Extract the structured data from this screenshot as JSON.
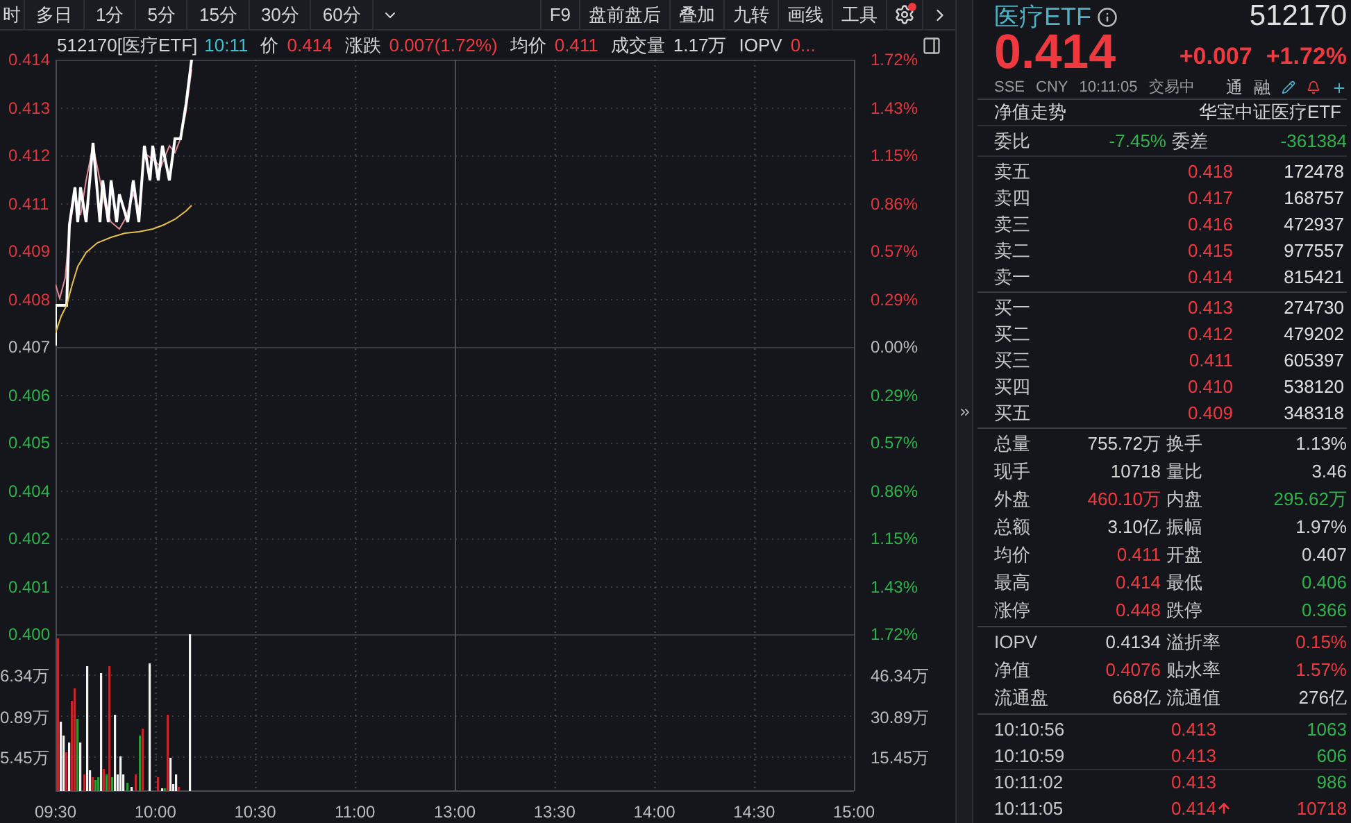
{
  "toolbar": {
    "periods": [
      {
        "label": "时"
      },
      {
        "label": "多日"
      },
      {
        "label": "1分"
      },
      {
        "label": "5分"
      },
      {
        "label": "15分"
      },
      {
        "label": "30分"
      },
      {
        "label": "60分"
      }
    ],
    "tools": [
      "F9",
      "盘前盘后",
      "叠加",
      "九转",
      "画线",
      "工具"
    ],
    "settings_alert": true
  },
  "info_bar": {
    "title": "512170[医疗ETF]",
    "time": "10:11",
    "fields": [
      {
        "label": "价",
        "value": "0.414",
        "color": "#f0393f"
      },
      {
        "label": "涨跌",
        "value": "0.007(1.72%)",
        "color": "#f0393f"
      },
      {
        "label": "均价",
        "value": "0.411",
        "color": "#f0393f"
      },
      {
        "label": "成交量",
        "value": "1.17万",
        "color": "#d6d6d6"
      },
      {
        "label": "IOPV",
        "value": "0...",
        "color": "#f0393f"
      }
    ]
  },
  "chart": {
    "price_labels": [
      {
        "text": "0.414",
        "color": "#e0383e"
      },
      {
        "text": "0.413",
        "color": "#e0383e"
      },
      {
        "text": "0.412",
        "color": "#e0383e"
      },
      {
        "text": "0.411",
        "color": "#e0383e"
      },
      {
        "text": "0.409",
        "color": "#e0383e"
      },
      {
        "text": "0.408",
        "color": "#e0383e"
      },
      {
        "text": "0.407",
        "color": "#bdbdbd"
      },
      {
        "text": "0.406",
        "color": "#2fb34a"
      },
      {
        "text": "0.405",
        "color": "#2fb34a"
      },
      {
        "text": "0.404",
        "color": "#2fb34a"
      },
      {
        "text": "0.402",
        "color": "#2fb34a"
      },
      {
        "text": "0.401",
        "color": "#2fb34a"
      },
      {
        "text": "0.400",
        "color": "#2fb34a"
      }
    ],
    "percent_labels": [
      {
        "text": "1.72%",
        "color": "#e0383e"
      },
      {
        "text": "1.43%",
        "color": "#e0383e"
      },
      {
        "text": "1.15%",
        "color": "#e0383e"
      },
      {
        "text": "0.86%",
        "color": "#e0383e"
      },
      {
        "text": "0.57%",
        "color": "#e0383e"
      },
      {
        "text": "0.29%",
        "color": "#e0383e"
      },
      {
        "text": "0.00%",
        "color": "#bdbdbd"
      },
      {
        "text": "0.29%",
        "color": "#2fb34a"
      },
      {
        "text": "0.57%",
        "color": "#2fb34a"
      },
      {
        "text": "0.86%",
        "color": "#2fb34a"
      },
      {
        "text": "1.15%",
        "color": "#2fb34a"
      },
      {
        "text": "1.43%",
        "color": "#2fb34a"
      },
      {
        "text": "1.72%",
        "color": "#2fb34a"
      }
    ],
    "volume_labels_left": [
      "6.34万",
      "0.89万",
      "5.45万"
    ],
    "volume_labels_right": [
      "46.34万",
      "30.89万",
      "15.45万"
    ],
    "time_labels": [
      "09:30",
      "10:00",
      "10:30",
      "11:00",
      "13:00",
      "13:30",
      "14:00",
      "14:30",
      "15:00"
    ]
  },
  "quote": {
    "name": "医疗ETF",
    "code": "512170",
    "price": "0.414",
    "change": "+0.007",
    "change_pct": "+1.72%",
    "exchange": "SSE",
    "currency": "CNY",
    "time": "10:11:05",
    "status": "交易中",
    "flags": [
      "通",
      "融"
    ],
    "nav_link": "净值走势",
    "fund_name": "华宝中证医疗ETF",
    "ratio": {
      "label": "委比",
      "value": "-7.45%",
      "diff_label": "委差",
      "diff_value": "-361384"
    },
    "asks": [
      {
        "label": "卖五",
        "price": "0.418",
        "volume": "172478"
      },
      {
        "label": "卖四",
        "price": "0.417",
        "volume": "168757"
      },
      {
        "label": "卖三",
        "price": "0.416",
        "volume": "472937"
      },
      {
        "label": "卖二",
        "price": "0.415",
        "volume": "977557"
      },
      {
        "label": "卖一",
        "price": "0.414",
        "volume": "815421"
      }
    ],
    "bids": [
      {
        "label": "买一",
        "price": "0.413",
        "volume": "274730"
      },
      {
        "label": "买二",
        "price": "0.412",
        "volume": "479202"
      },
      {
        "label": "买三",
        "price": "0.411",
        "volume": "605397"
      },
      {
        "label": "买四",
        "price": "0.410",
        "volume": "538120"
      },
      {
        "label": "买五",
        "price": "0.409",
        "volume": "348318"
      }
    ],
    "stats": [
      {
        "left": {
          "label": "总量",
          "value": "755.72万",
          "color": "#d6d6d6"
        },
        "right": {
          "label": "换手",
          "value": "1.13%",
          "color": "#d6d6d6"
        }
      },
      {
        "left": {
          "label": "现手",
          "value": "10718",
          "color": "#d6d6d6"
        },
        "right": {
          "label": "量比",
          "value": "3.46",
          "color": "#d6d6d6"
        }
      },
      {
        "left": {
          "label": "外盘",
          "value": "460.10万",
          "color": "#f0393f"
        },
        "right": {
          "label": "内盘",
          "value": "295.62万",
          "color": "#2fb34a"
        }
      },
      {
        "left": {
          "label": "总额",
          "value": "3.10亿",
          "color": "#d6d6d6"
        },
        "right": {
          "label": "振幅",
          "value": "1.97%",
          "color": "#d6d6d6"
        }
      },
      {
        "left": {
          "label": "均价",
          "value": "0.411",
          "color": "#f0393f"
        },
        "right": {
          "label": "开盘",
          "value": "0.407",
          "color": "#d6d6d6"
        }
      },
      {
        "left": {
          "label": "最高",
          "value": "0.414",
          "color": "#f0393f"
        },
        "right": {
          "label": "最低",
          "value": "0.406",
          "color": "#2fb34a"
        }
      },
      {
        "left": {
          "label": "涨停",
          "value": "0.448",
          "color": "#f0393f"
        },
        "right": {
          "label": "跌停",
          "value": "0.366",
          "color": "#2fb34a"
        }
      }
    ],
    "fund_stats": [
      {
        "left": {
          "label": "IOPV",
          "value": "0.4134",
          "color": "#d6d6d6"
        },
        "right": {
          "label": "溢折率",
          "value": "0.15%",
          "color": "#f0393f"
        }
      },
      {
        "left": {
          "label": "净值",
          "value": "0.4076",
          "color": "#f0393f"
        },
        "right": {
          "label": "贴水率",
          "value": "1.57%",
          "color": "#f0393f"
        }
      },
      {
        "left": {
          "label": "流通盘",
          "value": "668亿",
          "color": "#d6d6d6"
        },
        "right": {
          "label": "流通值",
          "value": "276亿",
          "color": "#d6d6d6"
        }
      }
    ],
    "ticks": [
      {
        "time": "10:10:56",
        "price": "0.413",
        "volume": "1063",
        "color": "#2fb34a",
        "arrow": false
      },
      {
        "time": "10:10:59",
        "price": "0.413",
        "volume": "606",
        "color": "#2fb34a",
        "arrow": false
      },
      {
        "time": "10:11:02",
        "price": "0.413",
        "volume": "986",
        "color": "#2fb34a",
        "arrow": false
      },
      {
        "time": "10:11:05",
        "price": "0.414",
        "volume": "10718",
        "color": "#f0393f",
        "arrow": true
      }
    ]
  }
}
